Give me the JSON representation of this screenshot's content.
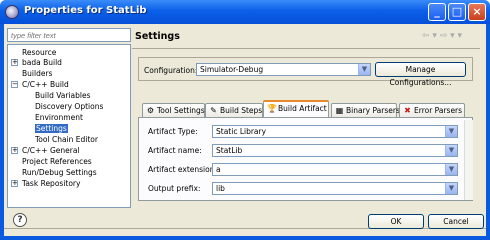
{
  "window": {
    "title": "Properties for StatLib",
    "min_glyph": "_",
    "max_glyph": "□",
    "close_glyph": "×"
  },
  "filter": {
    "placeholder": "type filter text"
  },
  "tree": {
    "items": [
      {
        "label": "Resource",
        "expander": ""
      },
      {
        "label": "bada Build",
        "expander": "+"
      },
      {
        "label": "Builders",
        "expander": ""
      },
      {
        "label": "C/C++ Build",
        "expander": "−"
      },
      {
        "label": "Build Variables",
        "expander": ""
      },
      {
        "label": "Discovery Options",
        "expander": ""
      },
      {
        "label": "Environment",
        "expander": ""
      },
      {
        "label": "Settings",
        "expander": ""
      },
      {
        "label": "Tool Chain Editor",
        "expander": ""
      },
      {
        "label": "C/C++ General",
        "expander": "+"
      },
      {
        "label": "Project References",
        "expander": ""
      },
      {
        "label": "Run/Debug Settings",
        "expander": ""
      },
      {
        "label": "Task Repository",
        "expander": "+"
      }
    ]
  },
  "panel": {
    "title": "Settings",
    "nav_glyphs": "⇦ ▾ ⇨ ▾ ▾"
  },
  "configuration": {
    "label": "Configuration:",
    "value": "Simulator-Debug",
    "manage_label": "Manage Configurations..."
  },
  "tabs": [
    {
      "label": "Tool Settings",
      "icon": "⚙"
    },
    {
      "label": "Build Steps",
      "icon": "✎"
    },
    {
      "label": "Build Artifact",
      "icon": "🏆"
    },
    {
      "label": "Binary Parsers",
      "icon": "▦"
    },
    {
      "label": "Error Parsers",
      "icon": "✖"
    }
  ],
  "artifact": {
    "type_label": "Artifact Type:",
    "type_value": "Static Library",
    "name_label": "Artifact name:",
    "name_value": "StatLib",
    "ext_label": "Artifact extension:",
    "ext_value": "a",
    "prefix_label": "Output prefix:",
    "prefix_value": "lib"
  },
  "footer": {
    "help_glyph": "?",
    "ok_label": "OK",
    "cancel_label": "Cancel"
  },
  "colors": {
    "title_bar": "#0b5fe8",
    "selection": "#316ac5",
    "active_tab_accent": "#e68b2c",
    "dialog_bg": "#ece9d8"
  }
}
